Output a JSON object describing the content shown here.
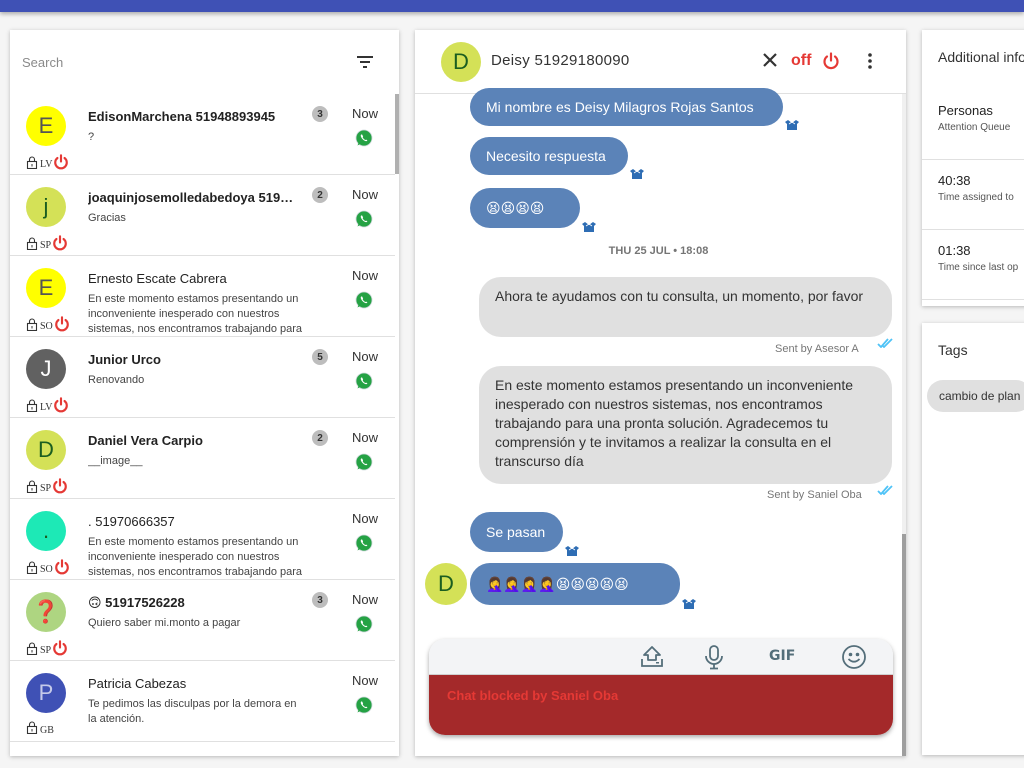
{
  "theme": {
    "primary": "#3f51b5",
    "incoming_bubble": "#5b83b8",
    "outgoing_bubble": "#e0e0e0",
    "danger": "#e53935",
    "blocked_bg": "#a4292a",
    "whatsapp": "#25a244"
  },
  "sidebar": {
    "search_placeholder": "Search",
    "conversations": [
      {
        "initial": "E",
        "avatar_color": "#ffff00",
        "initial_color": "#555555",
        "name": "EdisonMarchena 51948893945",
        "bold": true,
        "preview": "?",
        "unread": "3",
        "time": "Now",
        "agent": "LV",
        "locked": true,
        "online_power": true
      },
      {
        "initial": "j",
        "avatar_color": "#d4e157",
        "initial_color": "#1b5e20",
        "name": "joaquinjosemolledabedoya 51960…",
        "bold": true,
        "preview": "Gracias",
        "unread": "2",
        "time": "Now",
        "agent": "SP",
        "locked": true,
        "online_power": true
      },
      {
        "initial": "E",
        "avatar_color": "#ffff00",
        "initial_color": "#555555",
        "name": "Ernesto Escate Cabrera",
        "bold": false,
        "preview": "En este momento estamos presentando un inconveniente inesperado con nuestros sistemas, nos encontramos trabajando para",
        "unread": "",
        "time": "Now",
        "agent": "SO",
        "locked": true,
        "online_power": true
      },
      {
        "initial": "J",
        "avatar_color": "#616161",
        "initial_color": "#ffffff",
        "name": "Junior Urco",
        "bold": true,
        "preview": "Renovando",
        "unread": "5",
        "time": "Now",
        "agent": "LV",
        "locked": true,
        "online_power": true
      },
      {
        "initial": "D",
        "avatar_color": "#d4e157",
        "initial_color": "#1b5e20",
        "name": "Daniel Vera Carpio",
        "bold": true,
        "preview": "__image__",
        "unread": "2",
        "time": "Now",
        "agent": "SP",
        "locked": true,
        "online_power": true
      },
      {
        "initial": ".",
        "avatar_color": "#1de9b6",
        "initial_color": "#1b5e20",
        "name": ". 51970666357",
        "bold": false,
        "preview": "En este momento estamos presentando un inconveniente inesperado con nuestros sistemas, nos encontramos trabajando para",
        "unread": "",
        "time": "Now",
        "agent": "SO",
        "locked": true,
        "online_power": true
      },
      {
        "initial": "❓",
        "avatar_color": "#aed581",
        "initial_color": "#1b5e20",
        "name": "🙃 51917526228",
        "bold": true,
        "preview": "Quiero saber mi.monto a pagar",
        "unread": "3",
        "time": "Now",
        "agent": "SP",
        "locked": true,
        "online_power": true
      },
      {
        "initial": "P",
        "avatar_color": "#3f51b5",
        "initial_color": "#c5cae9",
        "name": "Patricia Cabezas",
        "bold": false,
        "preview": "Te pedimos las disculpas por la demora en la atención.",
        "unread": "",
        "time": "Now",
        "agent": "GB",
        "locked": true,
        "online_power": false
      }
    ]
  },
  "chat": {
    "contact_initial": "D",
    "contact_name": "Deisy 51929180090",
    "status_label": "off",
    "messages_in_top": [
      {
        "text": "Mi nombre es Deisy Milagros Rojas Santos"
      },
      {
        "text": "Necesito respuesta"
      },
      {
        "text": "😫😫😫😫"
      }
    ],
    "date_separator": "THU 25 JUL • 18:08",
    "messages_out": [
      {
        "text": "Ahora te ayudamos con tu consulta, un momento, por favor",
        "sent_by": "Sent by Asesor A"
      },
      {
        "text": "En este momento estamos presentando un inconveniente inesperado con nuestros sistemas, nos encontramos trabajando para una pronta solución. Agradecemos tu comprensión y te invitamos a realizar la consulta en el transcurso día",
        "sent_by": "Sent by Saniel Oba"
      }
    ],
    "messages_in_bottom": [
      {
        "text": "Se pasan"
      },
      {
        "text": "🤦‍♀️🤦‍♀️🤦‍♀️🤦‍♀️😫😫😫😫😫"
      }
    ],
    "composer": {
      "tools": [
        "upload-icon",
        "microphone-icon",
        "gif-icon",
        "emoji-icon"
      ],
      "gif_label": "GIF",
      "blocked_text": "Chat blocked by Saniel Oba"
    }
  },
  "info": {
    "title": "Additional info",
    "items": [
      {
        "value": "Personas",
        "label": "Attention Queue"
      },
      {
        "value": "40:38",
        "label": "Time assigned to"
      },
      {
        "value": "01:38",
        "label": "Time since last op"
      }
    ]
  },
  "tags": {
    "title": "Tags",
    "chips": [
      "cambio de plan"
    ]
  }
}
